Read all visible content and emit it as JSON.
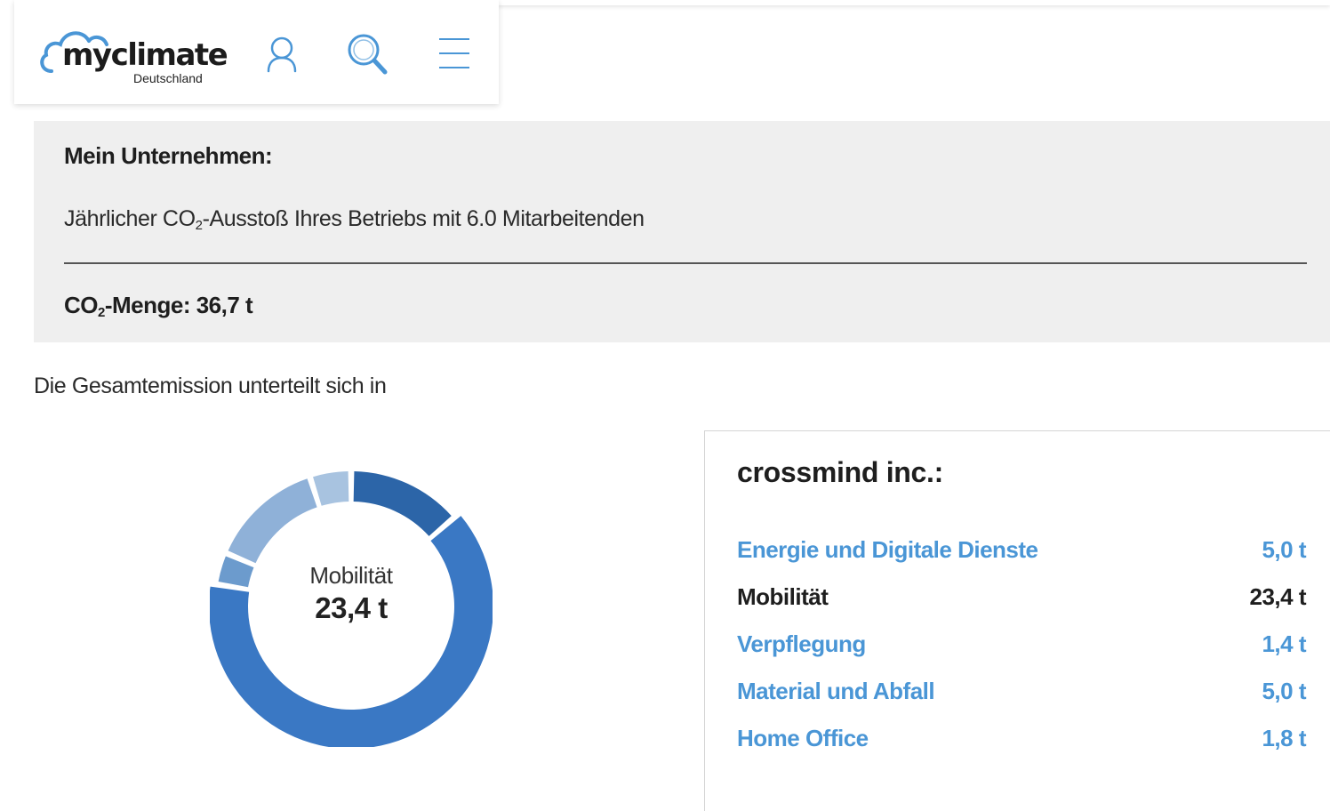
{
  "header": {
    "logo": {
      "word": "myclimate",
      "sub": "Deutschland"
    },
    "icons": [
      "user-icon",
      "search-icon",
      "menu-icon"
    ]
  },
  "summary": {
    "title": "Mein Unternehmen:",
    "desc_prefix": "Jährlicher CO",
    "desc_sub": "2",
    "desc_suffix": "-Ausstoß Ihres Betriebs mit 6.0 Mitarbeitenden",
    "amount_prefix": "CO",
    "amount_sub": "2",
    "amount_suffix": "-Menge: 36,7 t"
  },
  "intro": "Die Gesamtemission unterteilt sich in",
  "donut": {
    "center_label": "Mobilität",
    "center_value": "23,4 t"
  },
  "breakdown": {
    "title": "crossmind inc.:",
    "rows": [
      {
        "label": "Energie und Digitale Dienste",
        "value": "5,0 t",
        "active": false
      },
      {
        "label": "Mobilität",
        "value": "23,4 t",
        "active": true
      },
      {
        "label": "Verpflegung",
        "value": "1,4 t",
        "active": false
      },
      {
        "label": "Material und Abfall",
        "value": "5,0 t",
        "active": false
      },
      {
        "label": "Home Office",
        "value": "1,8 t",
        "active": false
      }
    ]
  },
  "chart_data": {
    "type": "pie",
    "categories": [
      "Energie und Digitale Dienste",
      "Mobilität",
      "Verpflegung",
      "Material und Abfall",
      "Home Office"
    ],
    "values": [
      5.0,
      23.4,
      1.4,
      5.0,
      1.8
    ],
    "colors": [
      "#2c65a8",
      "#3a78c4",
      "#6c9bcd",
      "#8fb1d8",
      "#a8c3e0"
    ],
    "highlighted": "Mobilität"
  },
  "colors": {
    "brand_blue": "#4a96d6",
    "icon_blue": "#4a96d6",
    "summary_bg": "#efefef"
  }
}
